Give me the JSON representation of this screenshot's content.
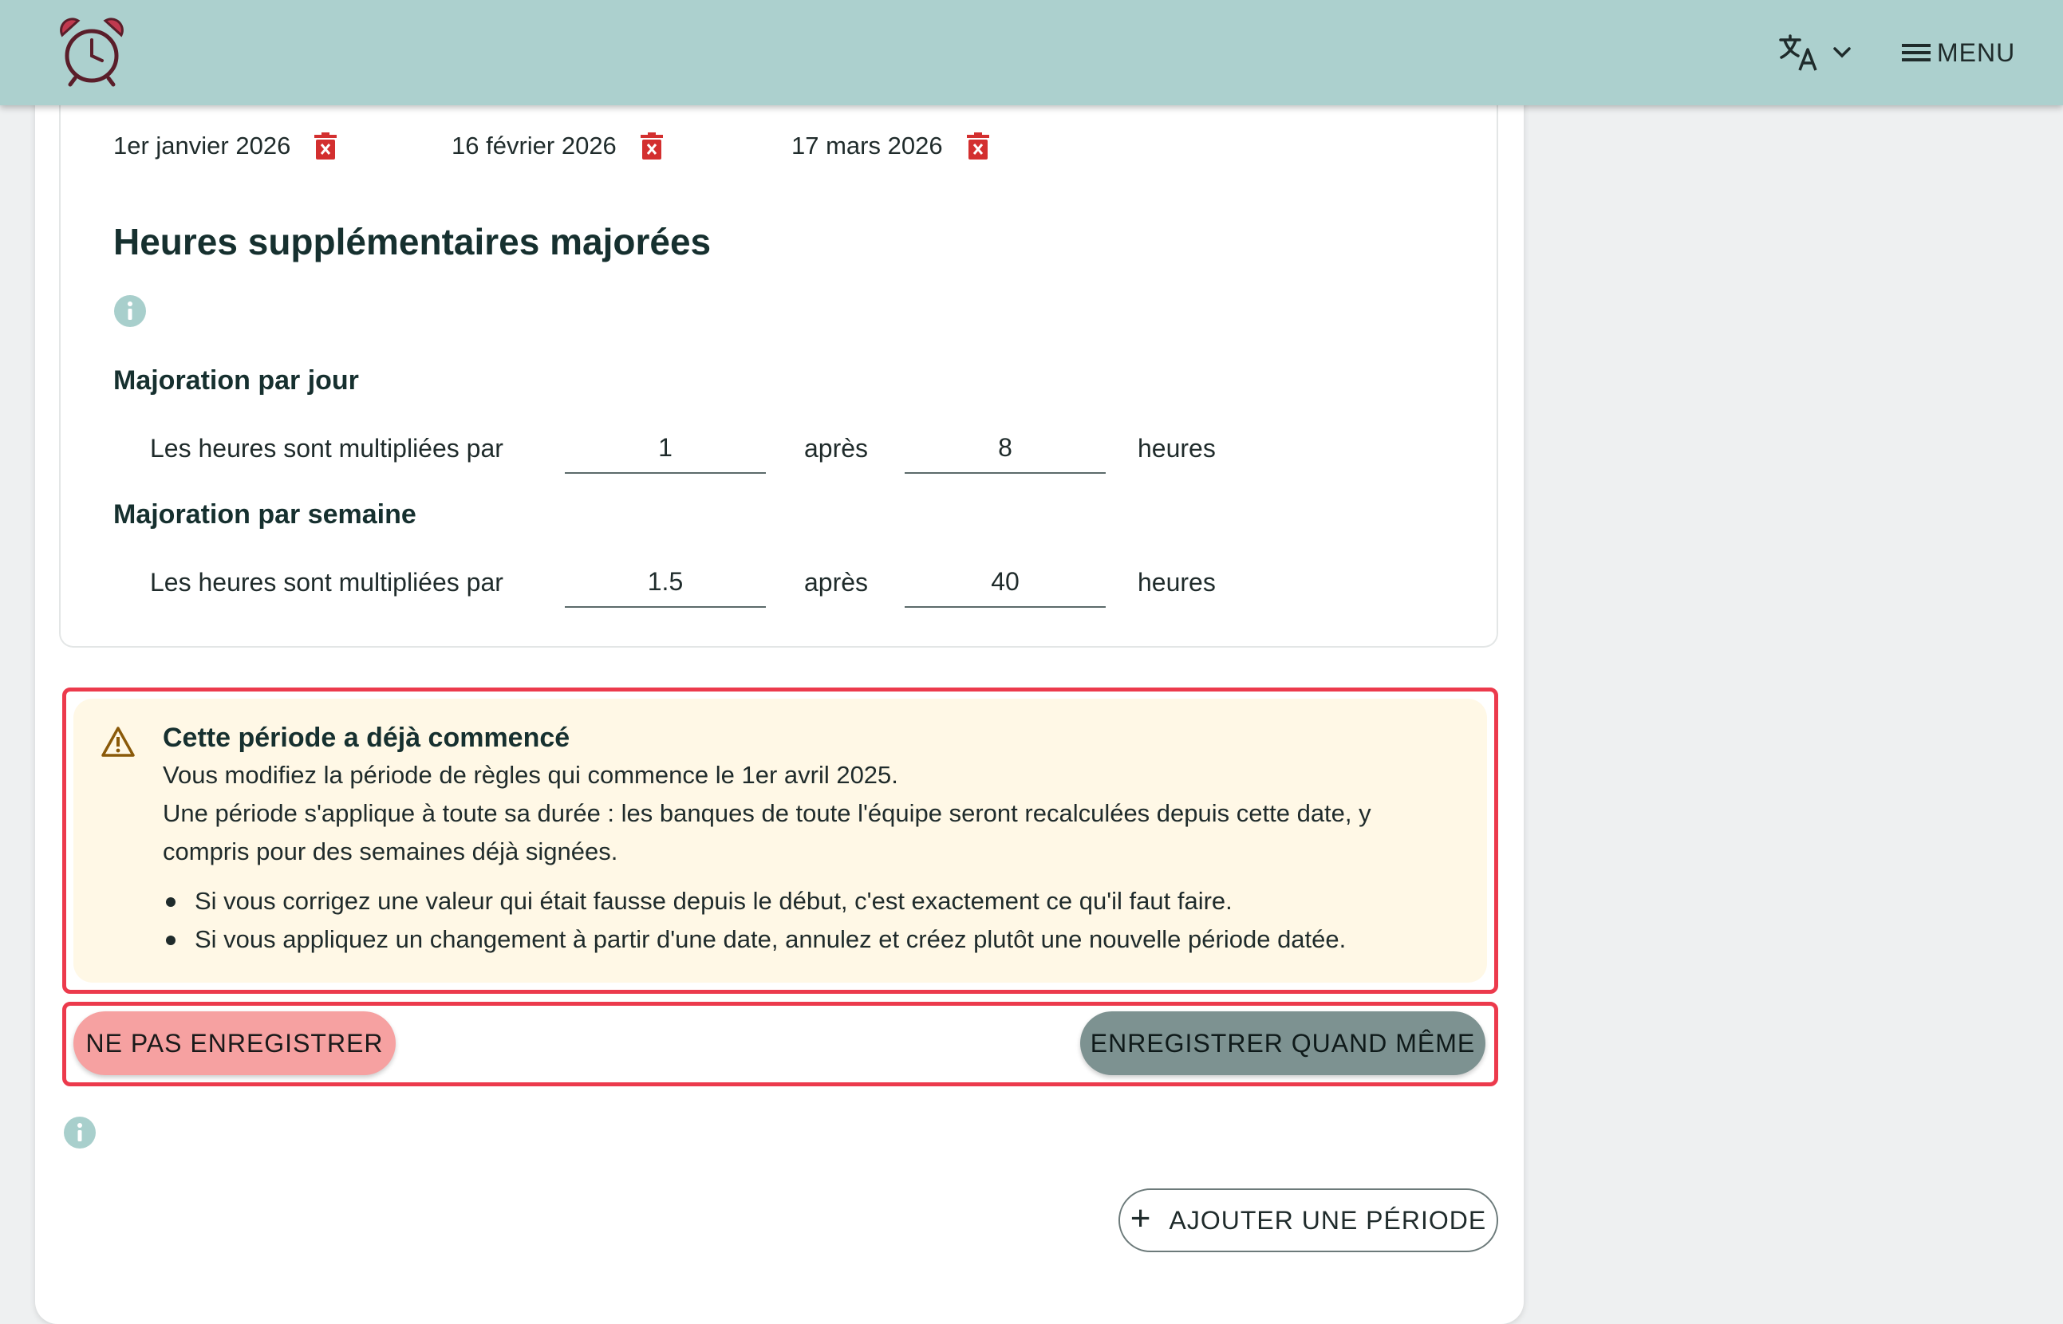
{
  "header": {
    "menu_label": "MENU",
    "icons": {
      "logo": "alarm-clock-icon",
      "language": "translate-icon",
      "chevron": "chevron-down-icon",
      "menu": "hamburger-icon"
    }
  },
  "holidays": [
    {
      "date": "1er janvier 2026"
    },
    {
      "date": "16 février 2026"
    },
    {
      "date": "17 mars 2026"
    }
  ],
  "overtime": {
    "title": "Heures supplémentaires majorées",
    "daily": {
      "title": "Majoration par jour",
      "label": "Les heures sont multipliées par",
      "multiplier": "1",
      "after_label": "après",
      "hours": "8",
      "unit": "heures"
    },
    "weekly": {
      "title": "Majoration par semaine",
      "label": "Les heures sont multipliées par",
      "multiplier": "1.5",
      "after_label": "après",
      "hours": "40",
      "unit": "heures"
    }
  },
  "warning": {
    "title": "Cette période a déjà commencé",
    "line1": "Vous modifiez la période de règles qui commence le 1er avril 2025.",
    "line2": "Une période s'applique à toute sa durée : les banques de toute l'équipe seront recalculées depuis cette date, y compris pour des semaines déjà signées.",
    "bullets": [
      "Si vous corrigez une valeur qui était fausse depuis le début, c'est exactement ce qu'il faut faire.",
      "Si vous appliquez un changement à partir d'une date, annulez et créez plutôt une nouvelle période datée."
    ]
  },
  "actions": {
    "cancel_label": "NE PAS ENREGISTRER",
    "save_label": "ENREGISTRER QUAND MÊME",
    "add_label": "AJOUTER UNE PÉRIODE"
  },
  "colors": {
    "header_bg": "#acd0ce",
    "warning_bg": "#fff8e6",
    "highlight_border": "#ec3a4c",
    "cancel_bg": "#f6a1a1",
    "save_bg": "#7d9291",
    "trash": "#d32f2f"
  }
}
